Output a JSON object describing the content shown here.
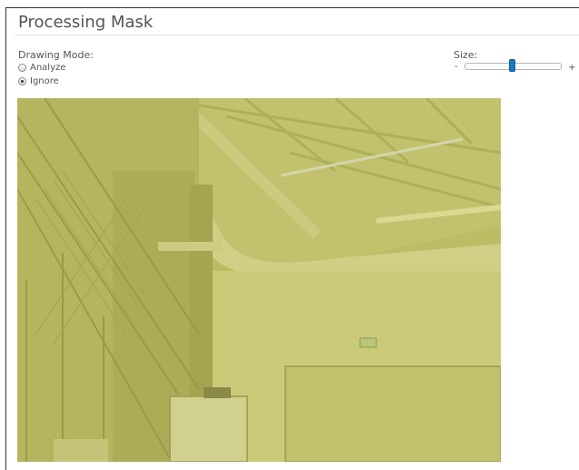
{
  "panel": {
    "title": "Processing Mask"
  },
  "drawing_mode": {
    "label": "Drawing Mode:",
    "options": [
      {
        "label": "Analyze",
        "checked": false
      },
      {
        "label": "Ignore",
        "checked": true
      }
    ]
  },
  "size": {
    "label": "Size:",
    "minus": "-",
    "plus": "+",
    "value_fraction": 0.49
  },
  "canvas": {
    "mask_color": "#c8c87c",
    "description_icon": "camera-preview-image"
  }
}
